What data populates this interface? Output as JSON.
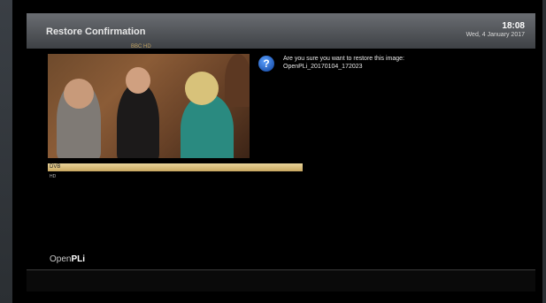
{
  "header": {
    "title": "Restore Confirmation",
    "time": "18:08",
    "date": "Wed, 4 January 2017"
  },
  "preview": {
    "channel_label": "BBC HD"
  },
  "progress": {
    "value_label": "DVB",
    "sub_label": "HD",
    "fraction": 1.0
  },
  "dialog": {
    "icon": "question-icon",
    "message_line1": "Are you sure you want to restore this image:",
    "message_line2": "OpenPLi_20170104_172023"
  },
  "footer": {
    "logo_prefix": "Open",
    "logo_suffix": "PLi"
  },
  "colors": {
    "header_gradient_top": "#6a6d72",
    "header_gradient_bottom": "#3e4145",
    "progress_fill": "#e8d39a",
    "icon_blue": "#1a5fd0"
  }
}
